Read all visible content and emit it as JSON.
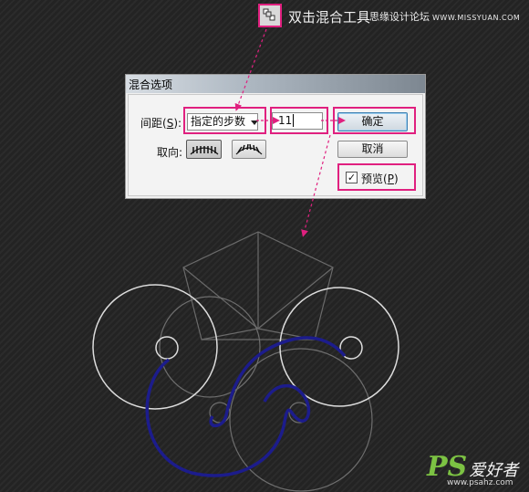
{
  "hint": {
    "caption": "双击混合工具",
    "watermark_name": "思缘设计论坛",
    "watermark_site": "WWW.MISSYUAN.COM",
    "tool_icon": "blend-tool-icon"
  },
  "dialog": {
    "title": "混合选项",
    "spacing_label_pre": "间距(",
    "spacing_label_key": "S",
    "spacing_label_post": "):",
    "spacing_selected": "指定的步数",
    "steps_value": "11",
    "ok_label": "确定",
    "cancel_label": "取消",
    "orientation_label": "取向:",
    "preview_label_pre": "预览(",
    "preview_label_key": "P",
    "preview_label_post": ")",
    "preview_checked": true
  },
  "colors": {
    "highlight": "#e0207f",
    "blend_path": "#1c1c8c",
    "shape_stroke": "#d8d8d8"
  },
  "watermark": {
    "ps": "PS",
    "name": "爱好者",
    "url": "www.psahz.com"
  }
}
